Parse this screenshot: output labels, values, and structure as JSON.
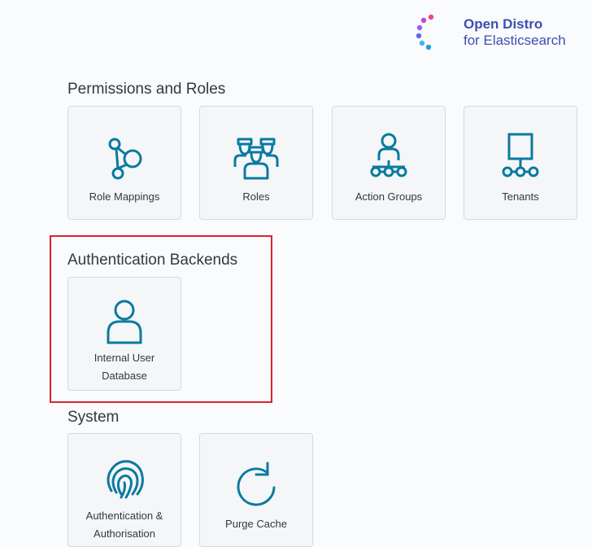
{
  "logo": {
    "line1": "Open Distro",
    "line2": "for Elasticsearch",
    "colors": {
      "text": "#3b50b0",
      "dots": [
        "#e8468f",
        "#c147d9",
        "#5c6de6",
        "#3eb8f0",
        "#2b9edb"
      ]
    }
  },
  "sections": {
    "permissions": {
      "title": "Permissions and Roles",
      "tiles": [
        {
          "label": "Role Mappings",
          "icon": "role-mappings-icon"
        },
        {
          "label": "Roles",
          "icon": "roles-icon"
        },
        {
          "label": "Action Groups",
          "icon": "action-groups-icon"
        },
        {
          "label": "Tenants",
          "icon": "tenants-icon"
        }
      ]
    },
    "auth_backends": {
      "title": "Authentication Backends",
      "tiles": [
        {
          "label_line1": "Internal User",
          "label_line2": "Database",
          "icon": "user-icon"
        }
      ]
    },
    "system": {
      "title": "System",
      "tiles": [
        {
          "label_line1": "Authentication &",
          "label_line2": "Authorisation",
          "icon": "fingerprint-icon"
        },
        {
          "label": "Purge Cache",
          "icon": "refresh-icon"
        }
      ]
    }
  },
  "colors": {
    "icon": "#0a7aa0",
    "highlight": "#d9232e",
    "tile_bg": "#f5f6f8",
    "tile_border": "#d3dae6"
  }
}
